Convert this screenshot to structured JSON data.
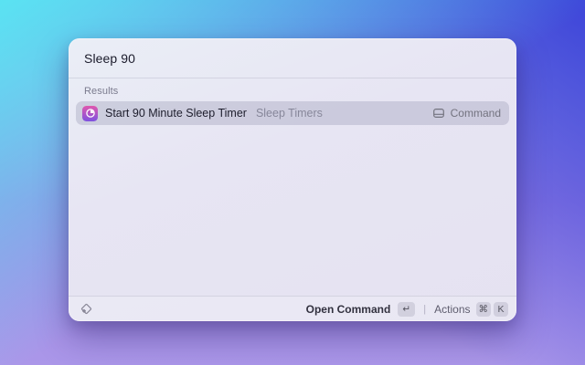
{
  "window": {
    "search": {
      "value": "Sleep 90"
    },
    "results": {
      "section_label": "Results",
      "items": [
        {
          "icon": "sleep-timer-app-icon",
          "title": "Start 90 Minute Sleep Timer",
          "subtitle": "Sleep Timers",
          "type_icon": "command-icon",
          "type_label": "Command",
          "selected": true
        }
      ]
    },
    "footer": {
      "logo_icon": "raycast-logo-icon",
      "primary_action": "Open Command",
      "primary_key": "↵",
      "divider": "|",
      "actions_label": "Actions",
      "actions_keys": [
        "⌘",
        "K"
      ]
    }
  },
  "colors": {
    "background_top_left": "#58e7f3",
    "background_top_right": "#393fd8",
    "background_bottom": "#ab97e9",
    "window_background": "#e7e5f3",
    "selected_row": "#c9c8d7",
    "app_icon_gradient_top": "#e058ae",
    "app_icon_gradient_bottom": "#7e52e0"
  }
}
